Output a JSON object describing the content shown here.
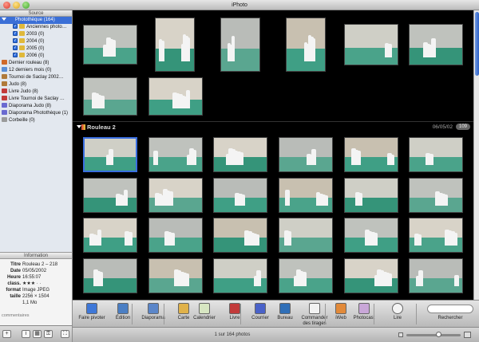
{
  "window": {
    "title": "iPhoto"
  },
  "sidebar": {
    "header": "Source",
    "items": [
      {
        "label": "Photothèque (164)",
        "kind": "library",
        "selected": true
      },
      {
        "label": "Anciennes photo…",
        "kind": "folder-check"
      },
      {
        "label": "2003 (0)",
        "kind": "folder-check"
      },
      {
        "label": "2004 (0)",
        "kind": "folder-check"
      },
      {
        "label": "2005 (0)",
        "kind": "folder-check"
      },
      {
        "label": "2006 (0)",
        "kind": "folder-check"
      },
      {
        "label": "Dernier rouleau (8)",
        "kind": "roll"
      },
      {
        "label": "12 derniers mois (0)",
        "kind": "calendar"
      },
      {
        "label": "Tournoi de Saclay 2002…",
        "kind": "album"
      },
      {
        "label": "Judo (8)",
        "kind": "album"
      },
      {
        "label": "Livre Judo (8)",
        "kind": "book"
      },
      {
        "label": "Livre Tournoi de Saclay …",
        "kind": "book"
      },
      {
        "label": "Diaporama Judo (8)",
        "kind": "slideshow"
      },
      {
        "label": "Diaporama Photothèque (1)",
        "kind": "slideshow"
      },
      {
        "label": "Corbeille (0)",
        "kind": "trash"
      }
    ]
  },
  "info": {
    "header": "Information",
    "rows": [
      {
        "k": "Titre",
        "v": "Rouleau 2 – 218"
      },
      {
        "k": "Date",
        "v": "05/05/2002"
      },
      {
        "k": "Heure",
        "v": "16:55:07"
      },
      {
        "k": "class.",
        "v": "★★★ · ·"
      },
      {
        "k": "format",
        "v": "Image JPEG"
      },
      {
        "k": "taille",
        "v": "2256 × 1504"
      },
      {
        "k": "",
        "v": "1,1 Mo"
      }
    ],
    "comments": "commentaires"
  },
  "roll": {
    "title": "Rouleau 2",
    "date": "06/05/02",
    "count": "109"
  },
  "toolbar": {
    "items": [
      {
        "label": "Faire pivoter",
        "icon": "rotate-icon",
        "color": "#3f78d8"
      },
      {
        "label": "Édition",
        "icon": "edit-icon",
        "color": "#4b7fc4"
      },
      {
        "label": "Diaporama",
        "icon": "slideshow-icon",
        "color": "#5b86c9"
      },
      {
        "label": "Carte",
        "icon": "card-icon",
        "color": "#e0b24a"
      },
      {
        "label": "Calendrier",
        "icon": "calendar-icon",
        "color": "#d7e6c2"
      },
      {
        "label": "Livre",
        "icon": "book-icon",
        "color": "#c23a3a"
      },
      {
        "label": "Courrier",
        "icon": "mail-icon",
        "color": "#4a62c9"
      },
      {
        "label": "Bureau",
        "icon": "desktop-icon",
        "color": "#2f6fb8"
      },
      {
        "label": "Commander\ndes tirages",
        "icon": "prints-icon",
        "color": "#f2f2f2"
      },
      {
        "label": "iWeb",
        "icon": "iweb-icon",
        "color": "#e28a3a"
      },
      {
        "label": "Photocast",
        "icon": "photocast-icon",
        "color": "#c9a7d8"
      },
      {
        "label": "Lire",
        "icon": "play-icon",
        "color": "#f4f4f4"
      }
    ],
    "search_label": "Rechercher"
  },
  "status": {
    "text": "1 sur 164 photos",
    "zoom": 0.6
  }
}
